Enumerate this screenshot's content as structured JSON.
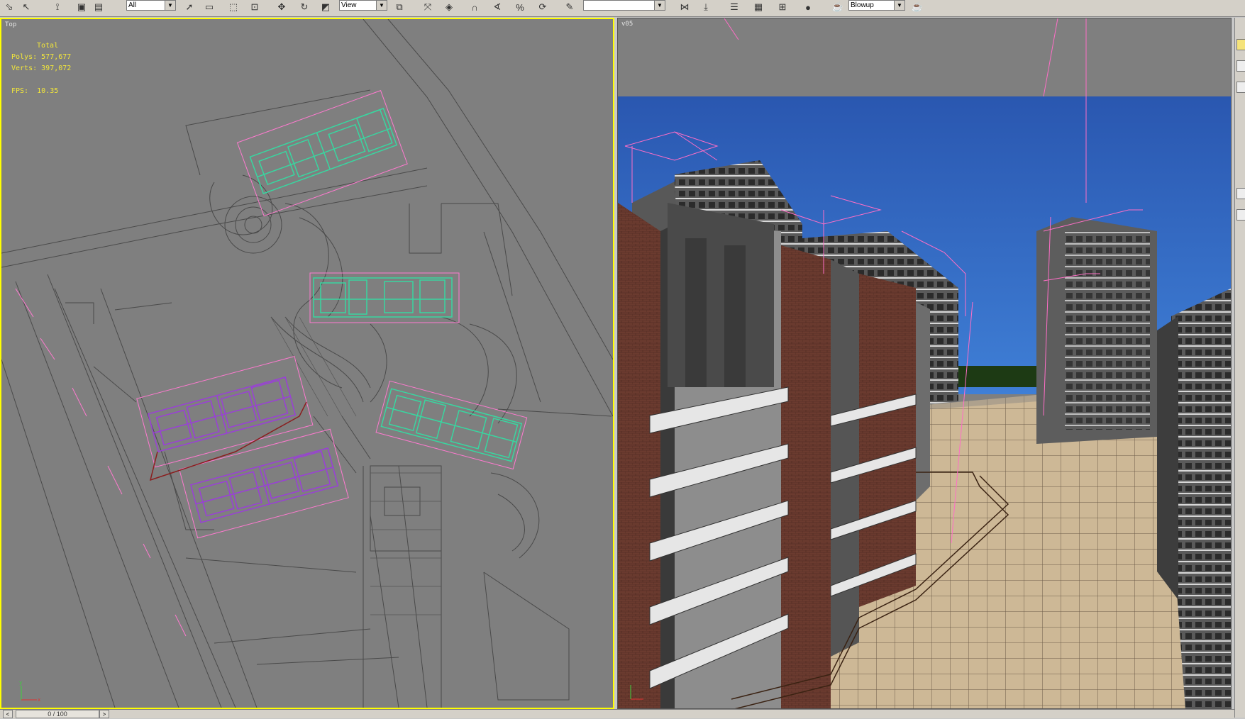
{
  "toolbar": {
    "selection_filter": "All",
    "reference_coord": "View",
    "named_selection": "",
    "render_preset": "Blowup",
    "icons": [
      "select-link-icon",
      "unlink-icon",
      "bind-spacewarp-icon",
      "select-icon",
      "select-by-name-icon",
      "rect-region-icon",
      "window-crossing-icon",
      "move-icon",
      "rotate-icon",
      "scale-icon",
      "pivot-icon",
      "snap-icon",
      "angle-snap-icon",
      "percent-snap-icon",
      "spinner-snap-icon",
      "edit-named-sel-icon",
      "mirror-icon",
      "align-icon",
      "layer-manager-icon",
      "curve-editor-icon",
      "schematic-view-icon",
      "material-editor-icon",
      "render-setup-icon",
      "render-icon"
    ]
  },
  "viewport_top": {
    "label": "Top",
    "stats": {
      "header": "Total",
      "polys_label": "Polys:",
      "polys": "577,677",
      "verts_label": "Verts:",
      "verts": "397,072",
      "fps_label": "FPS:",
      "fps": "10.35"
    }
  },
  "viewport_persp": {
    "label": "v05"
  },
  "timeslider": {
    "frame": "0 / 100"
  },
  "colors": {
    "viewport_bg": "#7f7f7f",
    "active_border": "#ffff00",
    "stats_text": "#f2e63a",
    "selection_green": "#39d6a0",
    "selection_purple": "#9a3fd8",
    "bbox_pink": "#ff7ad0",
    "sky": "#2e62b5",
    "brick": "#6a3a2e",
    "pavement": "#cbb694"
  }
}
